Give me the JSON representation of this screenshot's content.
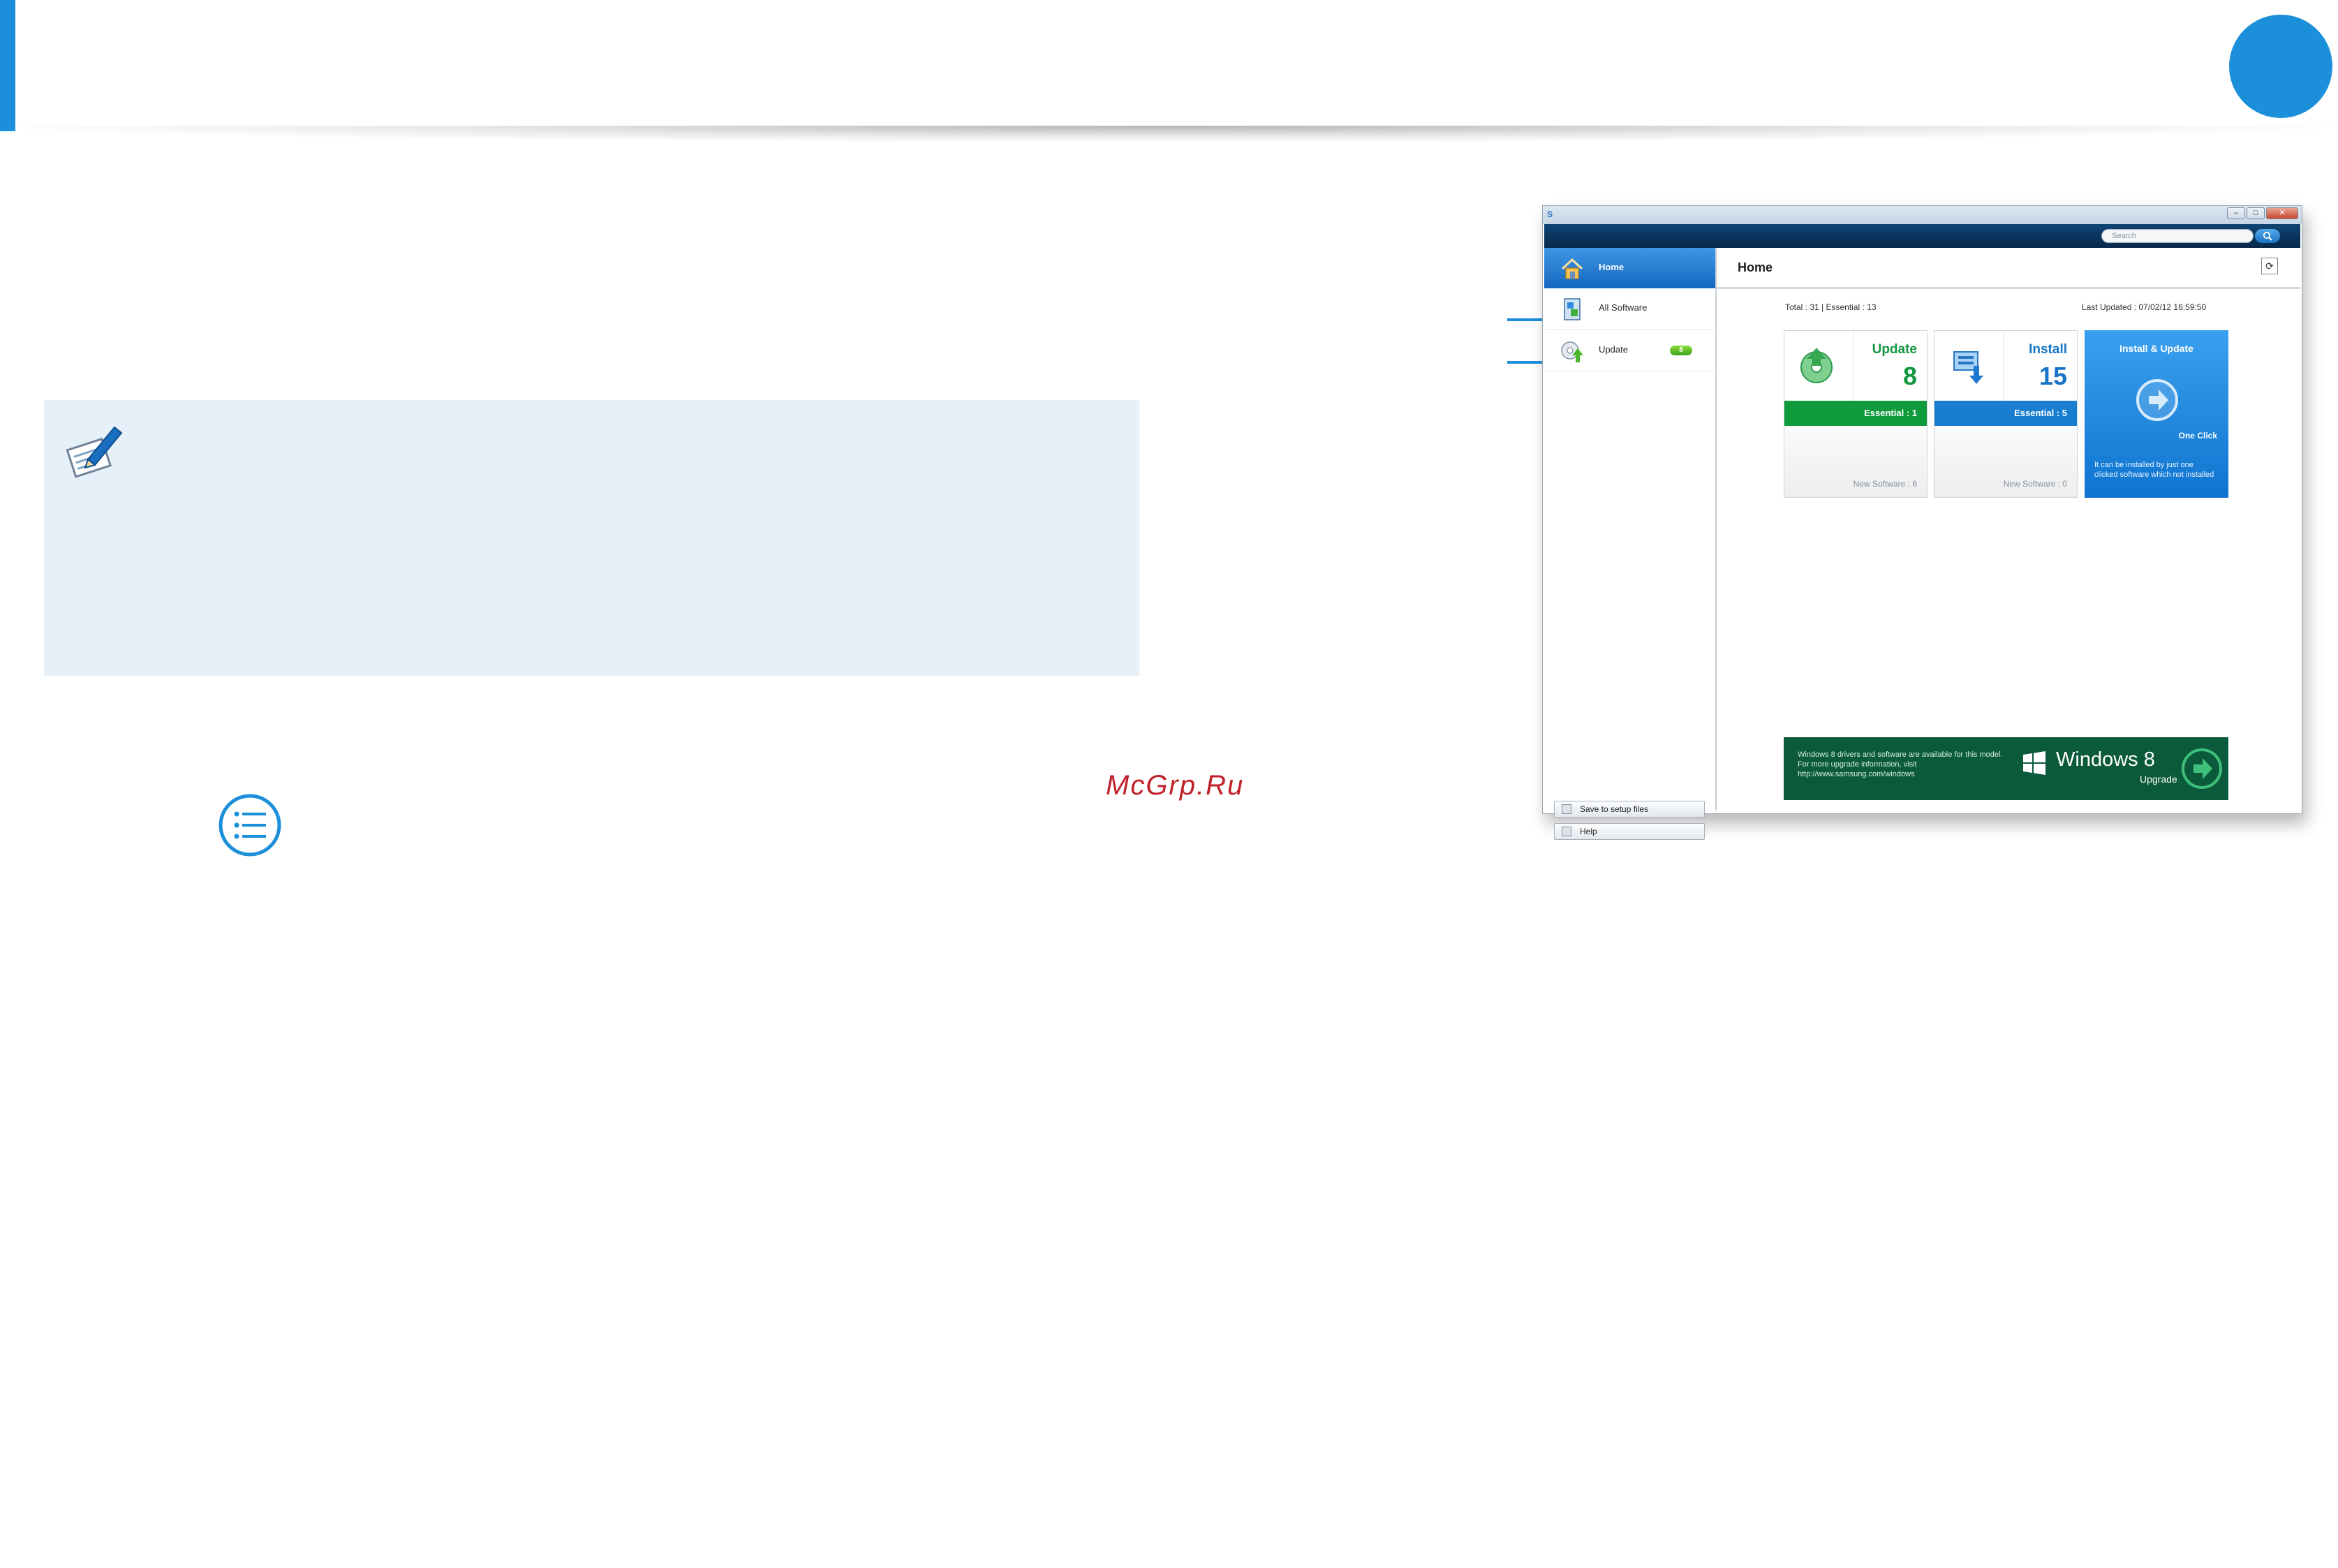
{
  "watermark": "McGrp.Ru",
  "app": {
    "search_placeholder": "Search",
    "window_controls": {
      "minimize": "–",
      "maximize": "□",
      "close": "✕"
    },
    "sidebar": {
      "items": [
        {
          "label": "Home",
          "icon": "home-icon",
          "active": true
        },
        {
          "label": "All Software",
          "icon": "all-software-icon"
        },
        {
          "label": "Update",
          "icon": "update-icon",
          "badge": "8"
        }
      ],
      "buttons": {
        "save_setup": "Save to setup files",
        "help": "Help"
      }
    },
    "main": {
      "title": "Home",
      "stats": {
        "total": "Total : 31 | Essential : 13",
        "last_updated": "Last Updated : 07/02/12 16:59:50"
      },
      "tiles": {
        "update": {
          "title": "Update",
          "count": "8",
          "essential": "Essential : 1",
          "new_software": "New Software : 6"
        },
        "install": {
          "title": "Install",
          "count": "15",
          "essential": "Essential : 5",
          "new_software": "New Software : 0"
        },
        "one_click": {
          "title": "Install & Update",
          "label": "One Click",
          "description": "It can be installed by just one clicked software which not installed"
        }
      },
      "win8_banner": {
        "text": "Windows 8 drivers and software are available for this model. For more upgrade information, visit http://www.samsung.com/windows",
        "name": "Windows 8",
        "upgrade": "Upgrade"
      }
    }
  },
  "colors": {
    "accent": "#1b8fd9",
    "note_bg": "#e6f0f9",
    "update_green": "#0f9a3c",
    "install_blue": "#1a7ed0",
    "win8_green": "#0b5a3b",
    "watermark_red": "#c0212a"
  },
  "icons": [
    "note-pencil-icon",
    "menu-list-icon",
    "home-icon",
    "all-software-icon",
    "update-icon",
    "search-icon",
    "refresh-icon",
    "windows-logo-icon",
    "arrow-right-icon"
  ]
}
